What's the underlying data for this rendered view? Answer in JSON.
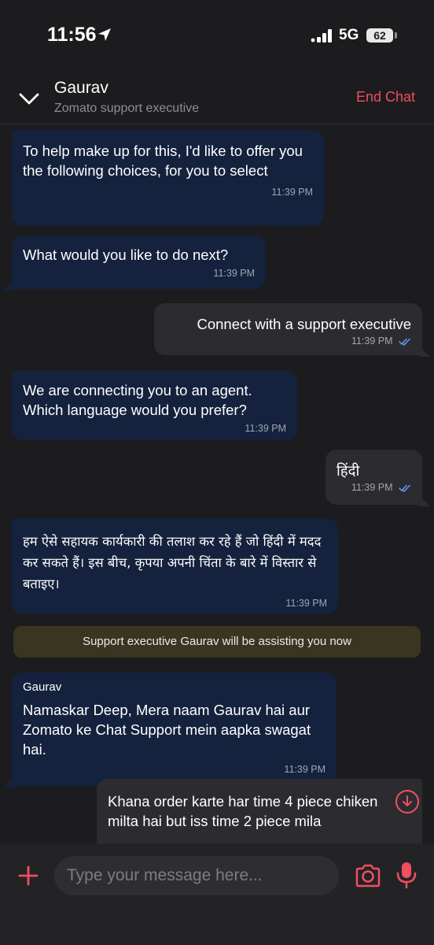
{
  "status_bar": {
    "time": "11:56",
    "network": "5G",
    "battery": "62"
  },
  "header": {
    "agent_name": "Gaurav",
    "agent_role": "Zomato support executive",
    "end_chat_label": "End Chat"
  },
  "messages": [
    {
      "direction": "in",
      "text": "To help make up for this, I'd like to offer you the following choices, for you to select",
      "time": "11:39 PM"
    },
    {
      "direction": "in",
      "text": "What would you like to do next?",
      "time": "11:39 PM"
    },
    {
      "direction": "out",
      "text": "Connect with a support executive",
      "time": "11:39 PM"
    },
    {
      "direction": "in",
      "text": "We are connecting you to an agent. Which language would you prefer?",
      "time": "11:39 PM"
    },
    {
      "direction": "out",
      "text": "हिंदी",
      "time": "11:39 PM"
    },
    {
      "direction": "in",
      "text": "हम ऐसे सहायक कार्यकारी की तलाश कर रहे हैं जो हिंदी में मदद कर सकते हैं। इस बीच, कृपया अपनी चिंता के बारे में विस्तार से बताइए।",
      "time": "11:39 PM"
    },
    {
      "direction": "in",
      "sender": "Gaurav",
      "text": "Namaskar Deep, Mera naam Gaurav hai aur Zomato ke Chat Support mein aapka swagat hai.",
      "time": "11:39 PM"
    },
    {
      "direction": "out",
      "text": "Khana order karte har time 4 piece chiken milta hai but iss time 2 piece mila"
    }
  ],
  "system_banner": "Support executive Gaurav will be assisting you now",
  "composer": {
    "placeholder": "Type your message here..."
  },
  "colors": {
    "accent": "#ef4f5f",
    "incoming_bubble": "#14223d",
    "outgoing_bubble": "#2c2c30",
    "read_tick": "#5b9cf5"
  }
}
